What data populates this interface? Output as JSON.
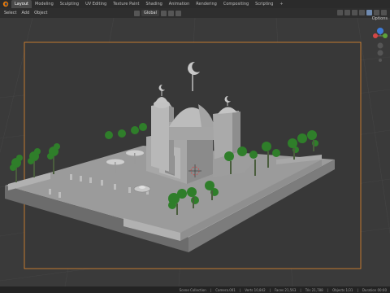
{
  "app": {
    "name": "Blender"
  },
  "workspaces": {
    "tabs": [
      {
        "label": "Layout",
        "active": true
      },
      {
        "label": "Modeling"
      },
      {
        "label": "Sculpting"
      },
      {
        "label": "UV Editing"
      },
      {
        "label": "Texture Paint"
      },
      {
        "label": "Shading"
      },
      {
        "label": "Animation"
      },
      {
        "label": "Rendering"
      },
      {
        "label": "Compositing"
      },
      {
        "label": "Scripting"
      }
    ],
    "add_label": "+"
  },
  "header": {
    "menu": [
      "Select",
      "Add",
      "Object"
    ],
    "orientation_label": "Global",
    "options_label": "Options"
  },
  "status": {
    "items": [
      "Scene Collection",
      "Camera.001",
      "Verts 10,842",
      "Faces 21,563",
      "Tris 21,788",
      "Objects 1/31",
      "Duration 00:00"
    ]
  },
  "colors": {
    "accent_active": "#6f8ab0",
    "camera_frame": "#e58a2e",
    "axis_x": "#d34747",
    "axis_y": "#5da23c",
    "axis_z": "#3d7bd8"
  },
  "icons": [
    "blender-logo-icon",
    "view-icon",
    "snap-icon",
    "proportional-icon",
    "overlay-icon",
    "shading-solid-icon",
    "navigation-gizmo-icon"
  ]
}
